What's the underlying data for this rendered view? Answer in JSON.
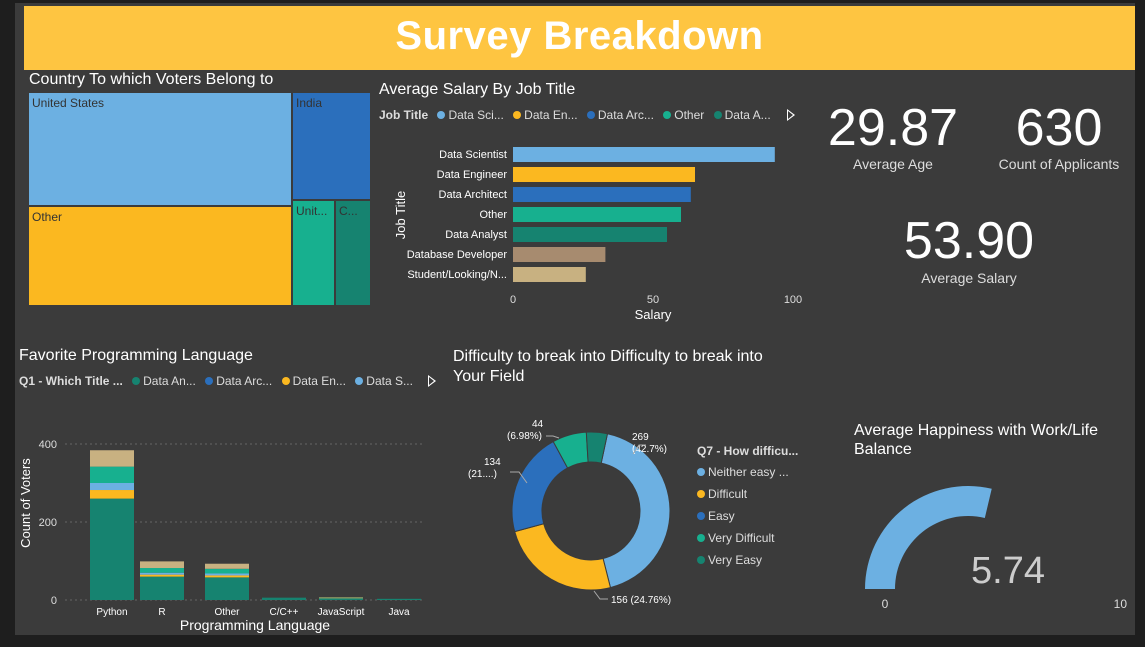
{
  "banner": {
    "title": "Survey Breakdown"
  },
  "treemap": {
    "title": "Country To which Voters Belong to",
    "cells": [
      {
        "label": "United States",
        "color": "#6cb0e2"
      },
      {
        "label": "Other",
        "color": "#fbb820"
      },
      {
        "label": "India",
        "color": "#2b6fbc"
      },
      {
        "label": "Unit...",
        "color": "#17b08f"
      },
      {
        "label": "C...",
        "color": "#168370"
      }
    ]
  },
  "salary_chart": {
    "title": "Average Salary By Job Title",
    "legend_title": "Job Title",
    "legend_items": [
      {
        "label": "Data Sci...",
        "color": "#6cb0e2"
      },
      {
        "label": "Data En...",
        "color": "#fbb820"
      },
      {
        "label": "Data Arc...",
        "color": "#2b6fbc"
      },
      {
        "label": "Other",
        "color": "#17b08f"
      },
      {
        "label": "Data A...",
        "color": "#168370"
      }
    ],
    "y_axis_title": "Job Title",
    "x_axis_title": "Salary",
    "ticks": [
      "0",
      "50",
      "100"
    ]
  },
  "kpis": {
    "avg_age": {
      "value": "29.87",
      "label": "Average Age"
    },
    "applicants": {
      "value": "630",
      "label": "Count of Applicants"
    },
    "avg_salary": {
      "value": "53.90",
      "label": "Average Salary"
    }
  },
  "language_chart": {
    "title": "Favorite Programming Language",
    "legend_title": "Q1 - Which Title ...",
    "legend_items": [
      {
        "label": "Data An...",
        "color": "#168370"
      },
      {
        "label": "Data Arc...",
        "color": "#2b6fbc"
      },
      {
        "label": "Data En...",
        "color": "#fbb820"
      },
      {
        "label": "Data S...",
        "color": "#6cb0e2"
      }
    ],
    "y_axis_title": "Count of Voters",
    "x_axis_title": "Programming Language",
    "y_ticks": [
      "0",
      "200",
      "400"
    ]
  },
  "difficulty_chart": {
    "title_line1": "Difficulty to break into Difficulty to break into",
    "title_line2": "Your Field",
    "legend_title": "Q7 - How difficu...",
    "legend_items": [
      {
        "label": "Neither easy ...",
        "color": "#6cb0e2"
      },
      {
        "label": "Difficult",
        "color": "#fbb820"
      },
      {
        "label": "Easy",
        "color": "#2b6fbc"
      },
      {
        "label": "Very Difficult",
        "color": "#17b08f"
      },
      {
        "label": "Very Easy",
        "color": "#168370"
      }
    ],
    "data_labels": [
      {
        "line1": "269",
        "line2": "(42.7%)"
      },
      {
        "line1": "156 (24.76%)",
        "line2": ""
      },
      {
        "line1": "134",
        "line2": "(21....)"
      },
      {
        "line1": "44",
        "line2": "(6.98%)"
      }
    ]
  },
  "gauge": {
    "title_line1": "Average Happiness with Work/Life",
    "title_line2": "Balance",
    "value_label": "5.74",
    "min_label": "0",
    "max_label": "10"
  },
  "chart_data": [
    {
      "type": "treemap",
      "title": "Country To which Voters Belong to",
      "categories": [
        "United States",
        "Other",
        "India",
        "Unit...",
        "C..."
      ],
      "values": [
        265,
        195,
        112,
        42,
        35
      ]
    },
    {
      "type": "bar",
      "orientation": "horizontal",
      "title": "Average Salary By Job Title",
      "categories": [
        "Data Scientist",
        "Data Engineer",
        "Data Architect",
        "Other",
        "Data Analyst",
        "Database Developer",
        "Student/Looking/N..."
      ],
      "values": [
        93.5,
        65,
        63.5,
        60,
        55,
        33,
        26
      ],
      "colors": [
        "#6cb0e2",
        "#fbb820",
        "#2b6fbc",
        "#17b08f",
        "#168370",
        "#a78b6f",
        "#c8b181"
      ],
      "xlabel": "Salary",
      "ylabel": "Job Title",
      "xlim": [
        0,
        100
      ]
    },
    {
      "type": "bar",
      "stacked": true,
      "title": "Favorite Programming Language",
      "categories": [
        "Python",
        "R",
        "Other",
        "C/C++",
        "JavaScript",
        "Java"
      ],
      "series": [
        {
          "name": "Data An...",
          "color": "#168370",
          "values": [
            260,
            60,
            58,
            6,
            4,
            3
          ]
        },
        {
          "name": "",
          "color": "#9aa66a",
          "values": [
            0,
            0,
            0,
            0,
            3,
            0
          ]
        },
        {
          "name": "Data En...",
          "color": "#fbb820",
          "values": [
            22,
            5,
            5,
            0,
            0,
            0
          ]
        },
        {
          "name": "Data S...",
          "color": "#6cb0e2",
          "values": [
            18,
            5,
            5,
            0,
            0,
            0
          ]
        },
        {
          "name": "",
          "color": "#17b08f",
          "values": [
            42,
            12,
            12,
            0,
            0,
            0
          ]
        },
        {
          "name": "",
          "color": "#c8b181",
          "values": [
            42,
            17,
            13,
            0,
            0,
            0
          ]
        }
      ],
      "xlabel": "Programming Language",
      "ylabel": "Count of Voters",
      "ylim": [
        0,
        430
      ]
    },
    {
      "type": "pie",
      "donut": true,
      "title": "Difficulty to break into Difficulty to break into Your Field",
      "categories": [
        "Neither easy ...",
        "Difficult",
        "Easy",
        "Very Difficult",
        "Very Easy"
      ],
      "values": [
        269,
        156,
        134,
        44,
        27
      ],
      "colors": [
        "#6cb0e2",
        "#fbb820",
        "#2b6fbc",
        "#17b08f",
        "#168370"
      ]
    },
    {
      "type": "gauge",
      "title": "Average Happiness with Work/Life Balance",
      "value": 5.74,
      "min": 0,
      "max": 10
    }
  ]
}
